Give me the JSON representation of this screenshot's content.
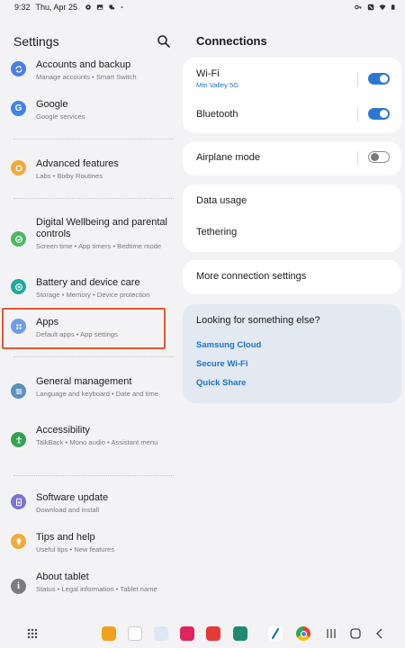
{
  "status_bar": {
    "time": "9:32",
    "date": "Thu, Apr 25"
  },
  "left": {
    "title": "Settings",
    "items": [
      {
        "title": "Accounts and backup",
        "subtitle": "Manage accounts  •  Smart Switch",
        "icon": "sync-icon",
        "color": "#4a7de8"
      },
      {
        "title": "Google",
        "subtitle": "Google services",
        "icon": "google-icon",
        "color": "#3f83ee"
      },
      {
        "title": "Advanced features",
        "subtitle": "Labs  •  Bixby Routines",
        "icon": "advanced-features-icon",
        "color": "#f3a93c"
      },
      {
        "title": "Digital Wellbeing and parental controls",
        "subtitle": "Screen time  •  App timers  •  Bedtime mode",
        "icon": "wellbeing-icon",
        "color": "#4cb860"
      },
      {
        "title": "Battery and device care",
        "subtitle": "Storage  •  Memory  •  Device protection",
        "icon": "device-care-icon",
        "color": "#22a99a"
      },
      {
        "title": "Apps",
        "subtitle": "Default apps  •  App settings",
        "icon": "apps-icon",
        "color": "#6f9be8"
      },
      {
        "title": "General management",
        "subtitle": "Language and keyboard  •  Date and time",
        "icon": "general-management-icon",
        "color": "#5a8fbf"
      },
      {
        "title": "Accessibility",
        "subtitle": "TalkBack  •  Mono audio  •  Assistant menu",
        "icon": "accessibility-icon",
        "color": "#35a252"
      },
      {
        "title": "Software update",
        "subtitle": "Download and install",
        "icon": "software-update-icon",
        "color": "#7b73d6"
      },
      {
        "title": "Tips and help",
        "subtitle": "Useful tips  •  New features",
        "icon": "tips-icon",
        "color": "#f3a93c"
      },
      {
        "title": "About tablet",
        "subtitle": "Status  •  Legal information  •  Tablet name",
        "icon": "info-icon",
        "color": "#7c7c80"
      }
    ]
  },
  "right": {
    "title": "Connections",
    "wifi": {
      "label": "Wi-Fi",
      "network": "Mtn Valley 5G",
      "enabled": true
    },
    "bluetooth": {
      "label": "Bluetooth",
      "enabled": true
    },
    "airplane": {
      "label": "Airplane mode",
      "enabled": false
    },
    "data_usage": "Data usage",
    "tethering": "Tethering",
    "more": "More connection settings",
    "looking": {
      "heading": "Looking for something else?",
      "links": [
        "Samsung Cloud",
        "Secure Wi-Fi",
        "Quick Share"
      ]
    }
  },
  "colors": {
    "accent": "#2a78d4",
    "highlight_border": "#e2562f",
    "link": "#1a73c9"
  }
}
